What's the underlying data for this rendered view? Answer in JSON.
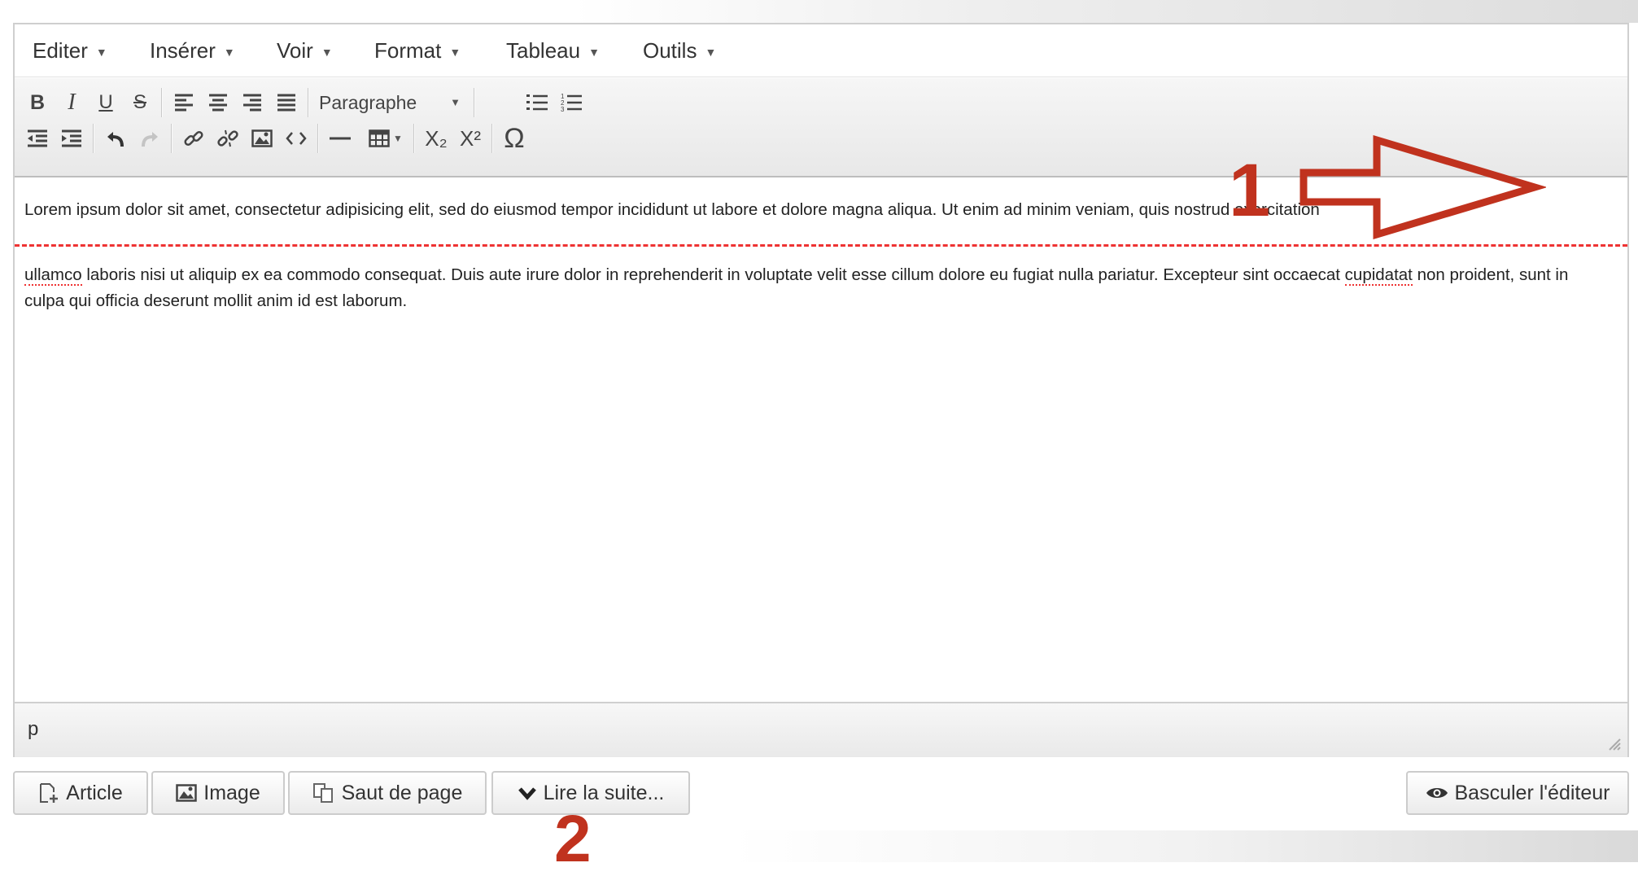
{
  "menubar": {
    "items": [
      {
        "label": "Editer"
      },
      {
        "label": "Insérer"
      },
      {
        "label": "Voir"
      },
      {
        "label": "Format"
      },
      {
        "label": "Tableau"
      },
      {
        "label": "Outils"
      }
    ]
  },
  "toolbar": {
    "bold_glyph": "B",
    "italic_glyph": "I",
    "underline_glyph": "U",
    "strike_glyph": "S",
    "format_select": "Paragraphe",
    "subscript_glyph": "X₂",
    "superscript_glyph": "X²",
    "special_char_glyph": "Ω"
  },
  "content": {
    "paragraph1": "Lorem ipsum dolor sit amet, consectetur adipisicing elit, sed do eiusmod tempor incididunt ut labore et dolore magna aliqua. Ut enim ad minim veniam, quis nostrud exercitation",
    "paragraph2_word1": "ullamco",
    "paragraph2_mid": " laboris nisi ut aliquip ex ea commodo consequat. Duis aute irure dolor in reprehenderit in voluptate velit esse cillum dolore eu fugiat nulla pariatur. Excepteur sint occaecat ",
    "paragraph2_word2": "cupidatat",
    "paragraph2_end": " non proident, sunt in culpa qui officia deserunt mollit anim id est laborum."
  },
  "statusbar": {
    "path": "p"
  },
  "buttons": {
    "article": "Article",
    "image": "Image",
    "page_break": "Saut de page",
    "read_more": "Lire la suite...",
    "toggle_editor": "Basculer l'éditeur"
  },
  "annotations": {
    "marker1": "1",
    "marker2": "2"
  },
  "colors": {
    "annotation": "#c0321e",
    "readmore_line": "#ee3333"
  }
}
